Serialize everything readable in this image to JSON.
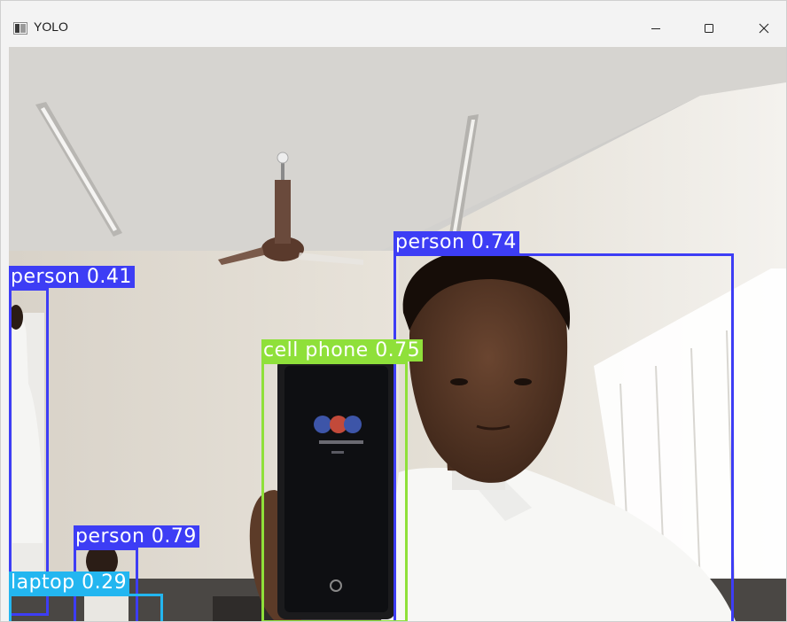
{
  "window": {
    "title": "YOLO",
    "controls": [
      "minimize",
      "maximize",
      "close"
    ]
  },
  "detections": [
    {
      "label": "person 0.74",
      "class": "person",
      "confidence": 0.74
    },
    {
      "label": "person 0.41",
      "class": "person",
      "confidence": 0.41
    },
    {
      "label": "cell phone 0.75",
      "class": "cell phone",
      "confidence": 0.75
    },
    {
      "label": "person 0.79",
      "class": "person",
      "confidence": 0.79
    },
    {
      "label": "laptop 0.29",
      "class": "laptop",
      "confidence": 0.29
    }
  ],
  "colors": {
    "person": "#3d3df5",
    "cell_phone": "#8fe03a",
    "laptop": "#23b6f0"
  }
}
